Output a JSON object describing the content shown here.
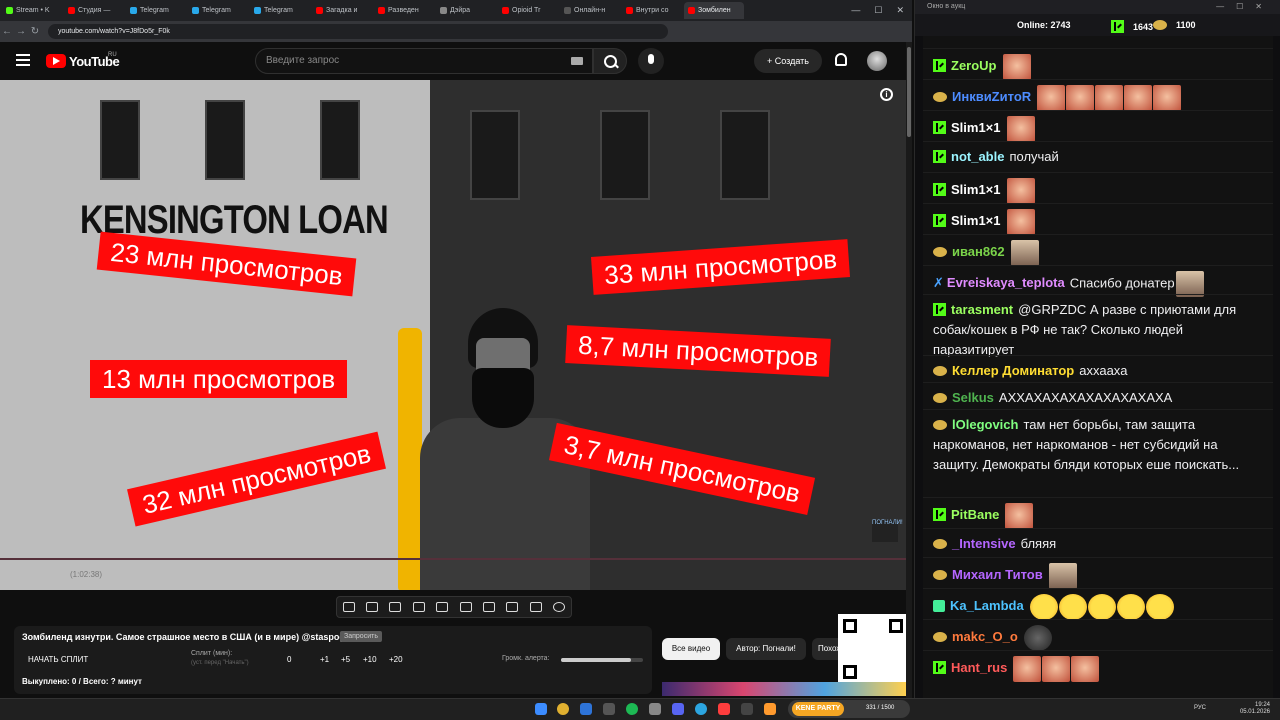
{
  "browser": {
    "tabs": [
      {
        "label": "Stream • K",
        "color": "#53fc18"
      },
      {
        "label": "Студия —",
        "color": "#ff0000"
      },
      {
        "label": "Telegram",
        "color": "#29a9eb"
      },
      {
        "label": "Telegram",
        "color": "#29a9eb"
      },
      {
        "label": "Telegram",
        "color": "#29a9eb"
      },
      {
        "label": "Загадка и",
        "color": "#ff0000"
      },
      {
        "label": "Разведен",
        "color": "#ff0000"
      },
      {
        "label": "Дэйра",
        "color": "#888888"
      },
      {
        "label": "Opioid Tr",
        "color": "#ff0000"
      },
      {
        "label": "Онлайн-н",
        "color": "#555555"
      },
      {
        "label": "Внутри со",
        "color": "#ff0000"
      },
      {
        "label": "Зомбилен",
        "color": "#ff0000"
      }
    ],
    "url": "youtube.com/watch?v=J8fDo5r_F0k"
  },
  "youtube": {
    "brand": "YouTube",
    "region": "RU",
    "search_placeholder": "Введите запрос",
    "create_label": "Создать"
  },
  "video": {
    "sign_text": "KENSINGTON LOAN",
    "view_stickers": [
      "23 млн просмотров",
      "33 млн просмотров",
      "13 млн просмотров",
      "8,7 млн просмотров",
      "32 млн просмотров",
      "3,7 млн просмотров"
    ],
    "channel_watermark": "ПОГНАЛИ!",
    "time_text": "(1:02:38)"
  },
  "panel": {
    "title": "Зомбиленд изнутри. Самое страшное место в США (и в мире) @staspognali",
    "tag": "Запросить",
    "start_split": "НАЧАТЬ СПЛИТ",
    "split_label": "Сплит (мин):",
    "split_sub": "(уст. перед \"Начать\")",
    "split_buttons": [
      "0",
      "+1",
      "+5",
      "+10",
      "+20"
    ],
    "volume_label": "Громк. алерта:",
    "volume_level": 0.85,
    "bought": "Выкуплено: 0 / Всего: ? минут"
  },
  "chips": {
    "all_videos": "Все видео",
    "author": "Автор: Погнали!",
    "similar": "Похожие"
  },
  "chat": {
    "window_title": "Окно в аукц",
    "online_label": "Online:",
    "online": "2743",
    "kick_count": "1643",
    "coin_count": "1100",
    "messages": [
      {
        "user": "ZeroUp",
        "color": "#9bff60",
        "badge": "kick",
        "text": "",
        "emotes": [
          "r"
        ]
      },
      {
        "user": "ИнквиZитоR",
        "color": "#4d8cff",
        "badge": "coin",
        "text": "",
        "emotes": [
          "r",
          "r",
          "r",
          "r",
          "r"
        ]
      },
      {
        "user": "Slim1×1",
        "color": "#ffffff",
        "badge": "kick",
        "text": "",
        "emotes": [
          "r"
        ]
      },
      {
        "user": "not_able",
        "color": "#9bf4ff",
        "badge": "kick",
        "text": "получай",
        "emotes": []
      },
      {
        "user": "Slim1×1",
        "color": "#ffffff",
        "badge": "kick",
        "text": "",
        "emotes": [
          "r"
        ]
      },
      {
        "user": "Slim1×1",
        "color": "#ffffff",
        "badge": "kick",
        "text": "",
        "emotes": [
          "r"
        ]
      },
      {
        "user": "иван862",
        "color": "#7bd44a",
        "badge": "coin",
        "text": "",
        "emotes": [
          "b"
        ]
      },
      {
        "user": "Evreiskaya_teplota",
        "color": "#e08cff",
        "badge": "sword",
        "text": "Спасибо донатер",
        "emotes": [
          "b"
        ]
      },
      {
        "user": "tarasment",
        "color": "#9bff60",
        "badge": "kick",
        "text": "@GRPZDC А разве с приютами для собак/кошек в РФ не так? Сколько людей паразитирует",
        "emotes": []
      },
      {
        "user": "Келлер Доминатор",
        "color": "#ffdd33",
        "badge": "coin",
        "text": "аххаахa",
        "emotes": []
      },
      {
        "user": "Selkus",
        "color": "#4fb34f",
        "badge": "coin",
        "text": "АХХАХАХАХАХАХАХАХАХА",
        "emotes": []
      },
      {
        "user": "lOlegovich",
        "color": "#80ff80",
        "badge": "coin",
        "text": "там нет борьбы, там защита наркоманов, нет наркоманов - нет субсидий на защиту. Демократы бляди которых еше поискать...",
        "emotes": []
      },
      {
        "user": "PitBane",
        "color": "#9bff60",
        "badge": "kick",
        "text": "",
        "emotes": [
          "r"
        ]
      },
      {
        "user": "_Intensive",
        "color": "#b466ff",
        "badge": "coin",
        "text": "бляяя",
        "emotes": []
      },
      {
        "user": "Михаил Титов",
        "color": "#b466ff",
        "badge": "coin",
        "text": "",
        "emotes": [
          "b"
        ]
      },
      {
        "user": "Ka_Lambda",
        "color": "#4dc3ff",
        "badge": "mod",
        "text": "",
        "emotes": [
          "y",
          "y",
          "y",
          "y",
          "y"
        ]
      },
      {
        "user": "makc_O_o",
        "color": "#ff7a3d",
        "badge": "coin",
        "text": "",
        "emotes": [
          "g"
        ]
      },
      {
        "user": "Hant_rus",
        "color": "#ff5a5a",
        "badge": "kick",
        "text": "",
        "emotes": [
          "r",
          "r",
          "r"
        ]
      }
    ]
  },
  "taskbar": {
    "kene_label": "KENE PARTY",
    "kene_count": "331 / 1500",
    "lang": "РУС",
    "time": "19:24",
    "date": "05.01.2026"
  }
}
